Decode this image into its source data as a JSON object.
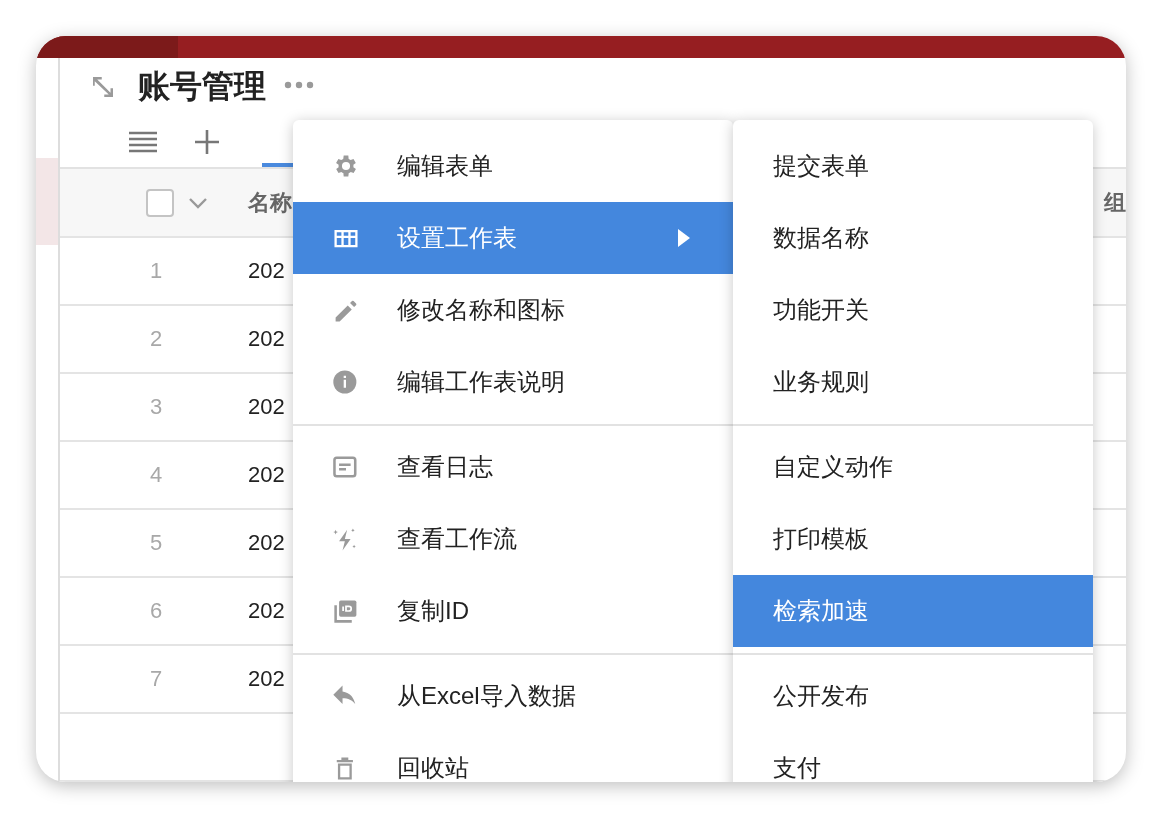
{
  "page": {
    "title": "账号管理"
  },
  "toolbar": {
    "tabs": [
      {
        "selected": true
      }
    ]
  },
  "table": {
    "select_all": {
      "checked": false
    },
    "columns": [
      "名称",
      "组"
    ],
    "rows": [
      {
        "number": "1",
        "name": "202"
      },
      {
        "number": "2",
        "name": "202"
      },
      {
        "number": "3",
        "name": "202"
      },
      {
        "number": "4",
        "name": "202"
      },
      {
        "number": "5",
        "name": "202"
      },
      {
        "number": "6",
        "name": "202"
      },
      {
        "number": "7",
        "name": "202"
      }
    ]
  },
  "menu": {
    "groups": [
      {
        "items": [
          {
            "label": "编辑表单",
            "selected": false,
            "submenu": false
          },
          {
            "label": "设置工作表",
            "selected": true,
            "submenu": true
          },
          {
            "label": "修改名称和图标",
            "selected": false,
            "submenu": false
          },
          {
            "label": "编辑工作表说明",
            "selected": false,
            "submenu": false
          }
        ]
      },
      {
        "items": [
          {
            "label": "查看日志",
            "selected": false,
            "submenu": false
          },
          {
            "label": "查看工作流",
            "selected": false,
            "submenu": false
          },
          {
            "label": "复制ID",
            "selected": false,
            "submenu": false
          }
        ]
      },
      {
        "items": [
          {
            "label": "从Excel导入数据",
            "selected": false,
            "submenu": false
          },
          {
            "label": "回收站",
            "selected": false,
            "submenu": false
          }
        ]
      }
    ]
  },
  "submenu": {
    "groups": [
      {
        "items": [
          {
            "label": "提交表单",
            "selected": false
          },
          {
            "label": "数据名称",
            "selected": false
          },
          {
            "label": "功能开关",
            "selected": false
          },
          {
            "label": "业务规则",
            "selected": false
          }
        ]
      },
      {
        "items": [
          {
            "label": "自定义动作",
            "selected": false
          },
          {
            "label": "打印模板",
            "selected": false
          },
          {
            "label": "检索加速",
            "selected": true
          }
        ]
      },
      {
        "items": [
          {
            "label": "公开发布",
            "selected": false
          },
          {
            "label": "支付",
            "selected": false
          }
        ]
      }
    ]
  }
}
